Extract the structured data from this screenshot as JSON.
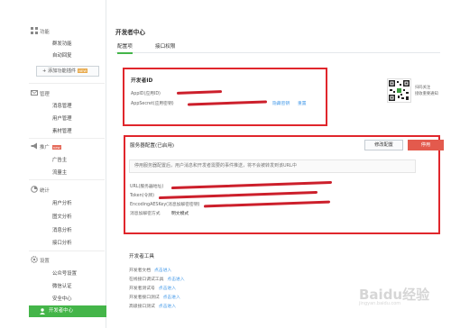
{
  "colors": {
    "accent": "#44b549",
    "highlight": "#e0262c",
    "link": "#459ae9",
    "danger": "#e35a4d"
  },
  "sidebar": {
    "sections": [
      {
        "icon": "grid-icon",
        "title": "功能",
        "items": [
          "群发功能",
          "自动回复"
        ]
      },
      {
        "icon": "envelope-icon",
        "title": "管理",
        "items": [
          "消息管理",
          "用户管理",
          "素材管理"
        ]
      },
      {
        "icon": "megaphone-icon",
        "title": "推广",
        "tag": "new",
        "items": [
          "广告主",
          "流量主"
        ]
      },
      {
        "icon": "chart-icon",
        "title": "统计",
        "items": [
          "用户分析",
          "图文分析",
          "消息分析",
          "接口分析"
        ]
      },
      {
        "icon": "gear-icon",
        "title": "设置",
        "items": [
          "公众号设置",
          "微信认证",
          "安全中心"
        ]
      }
    ],
    "add_plugin": {
      "label": "+ 添加功能插件",
      "tag": "NEW"
    },
    "active": {
      "icon": "user-icon",
      "label": "开发者中心"
    }
  },
  "main": {
    "title": "开发者中心",
    "tabs": [
      "配置项",
      "接口权限"
    ],
    "developer_id": {
      "title": "开发者ID",
      "appid_label": "AppID(应用ID)",
      "secret_label": "AppSecret(应用密钥)",
      "links": [
        "隐藏密钥",
        "重置"
      ]
    },
    "qr": {
      "line1": "扫码关注",
      "line2": "接收重要通知"
    },
    "server": {
      "title": "服务器配置(已启用)",
      "modify_label": "修改配置",
      "disable_label": "停用",
      "notice": "停用服务器配置后，用户消息和开发者需要的事件推送，将不会被转发到该URL中",
      "url_label": "URL(服务器地址)",
      "token_label": "Token(令牌)",
      "aes_label": "EncodingAESKey(消息加解密密钥)",
      "mode_label": "消息加解密方式",
      "mode_value": "明文模式"
    },
    "tools": {
      "title": "开发者工具",
      "items": [
        {
          "label": "开发者文档",
          "link": "点击进入"
        },
        {
          "label": "在线接口调试工具",
          "link": "点击进入"
        },
        {
          "label": "开发者测试号",
          "link": "点击进入"
        },
        {
          "label": "开发者接口测试",
          "link": "点击进入"
        },
        {
          "label": "高级接口测试",
          "link": "点击进入"
        }
      ]
    }
  },
  "watermark": {
    "text": "Baidu经验",
    "sub": "jingyan.baidu.com"
  }
}
